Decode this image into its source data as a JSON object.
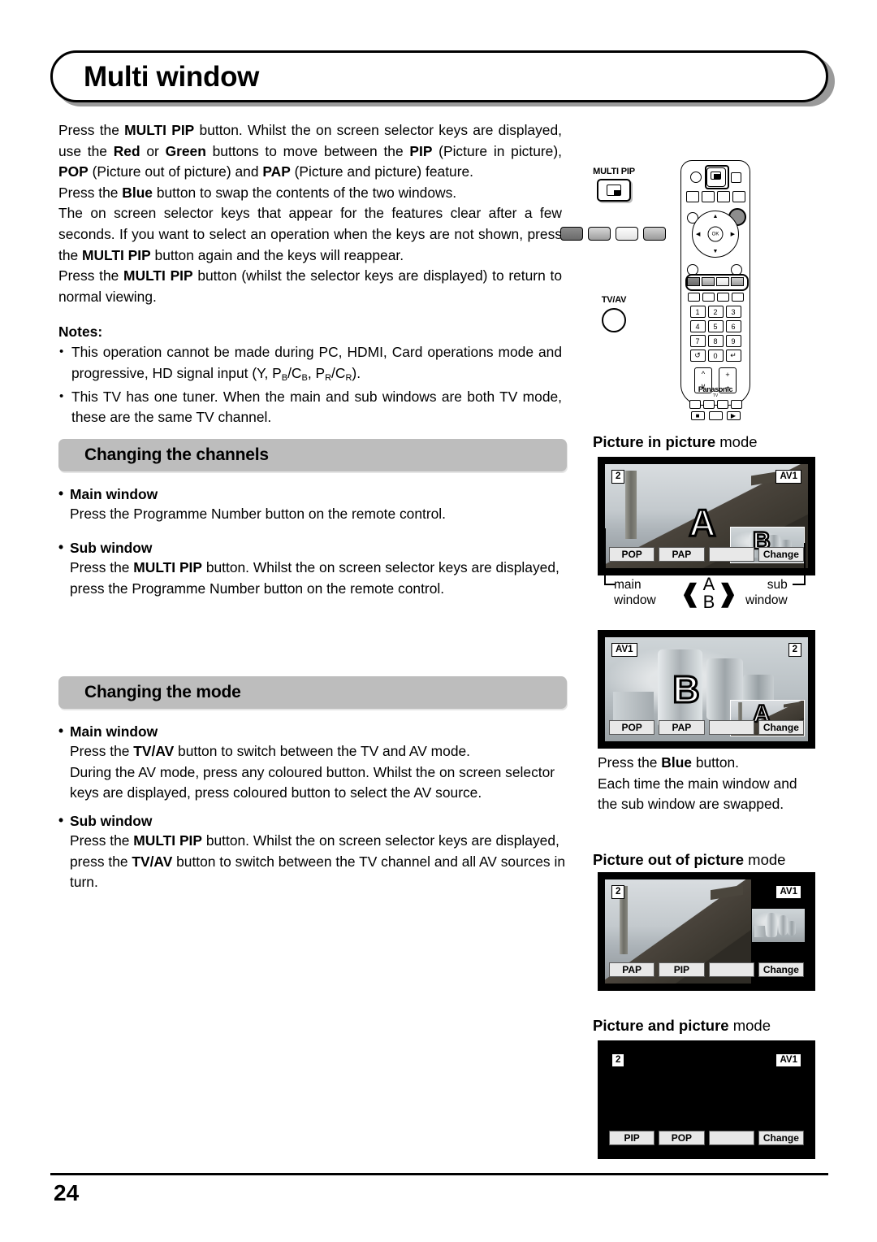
{
  "page": {
    "title": "Multi window",
    "number": "24"
  },
  "intro": {
    "para1_parts": [
      {
        "t": "Press the ",
        "b": false
      },
      {
        "t": "MULTI PIP",
        "b": true
      },
      {
        "t": " button. Whilst the on screen selector keys are displayed, use the ",
        "b": false
      },
      {
        "t": "Red",
        "b": true
      },
      {
        "t": " or ",
        "b": false
      },
      {
        "t": "Green",
        "b": true
      },
      {
        "t": " buttons to move between the ",
        "b": false
      },
      {
        "t": "PIP",
        "b": true
      },
      {
        "t": " (Picture in picture), ",
        "b": false
      },
      {
        "t": "POP",
        "b": true
      },
      {
        "t": " (Picture out of picture) and ",
        "b": false
      },
      {
        "t": "PAP",
        "b": true
      },
      {
        "t": " (Picture and picture) feature.",
        "b": false
      }
    ],
    "para2_parts": [
      {
        "t": "Press the ",
        "b": false
      },
      {
        "t": "Blue",
        "b": true
      },
      {
        "t": " button to swap the contents of the two windows.",
        "b": false
      }
    ],
    "para3_parts": [
      {
        "t": "The on screen selector keys that appear for the features clear after a few seconds. If you want to select an operation when the keys are not shown, press the ",
        "b": false
      },
      {
        "t": "MULTI PIP",
        "b": true
      },
      {
        "t": " button again and the keys will reappear.",
        "b": false
      }
    ],
    "para4_parts": [
      {
        "t": "Press the ",
        "b": false
      },
      {
        "t": "MULTI PIP",
        "b": true
      },
      {
        "t": " button (whilst the selector keys are displayed) to return to normal viewing.",
        "b": false
      }
    ]
  },
  "notes": {
    "heading": "Notes:",
    "items": [
      "This operation cannot be made during PC, HDMI, Card operations mode and progressive, HD signal input (Y, PB/CB, PR/CR).",
      "This TV has one tuner. When the main and sub windows are both TV mode, these are the same TV channel."
    ],
    "item1_pre": "This operation cannot be made during PC, HDMI, Card operations mode and progressive, HD signal input (Y, P",
    "item1_sub1": "B",
    "item1_mid1": "/C",
    "item1_sub2": "B",
    "item1_mid2": ", P",
    "item1_sub3": "R",
    "item1_mid3": "/C",
    "item1_sub4": "R",
    "item1_post": ")."
  },
  "remote": {
    "multipip_label": "MULTI PIP",
    "tvav_label": "TV/AV",
    "brand": "Panasonic",
    "brand_sub": "TV",
    "numbers": [
      "1",
      "2",
      "3",
      "4",
      "5",
      "6",
      "7",
      "8",
      "9",
      "0"
    ]
  },
  "sections": [
    {
      "title": "Changing the channels",
      "blocks": [
        {
          "head": "Main window",
          "body_parts": [
            {
              "t": "Press the Programme Number button on the remote control.",
              "b": false
            }
          ]
        },
        {
          "head": "Sub window",
          "body_parts": [
            {
              "t": "Press the ",
              "b": false
            },
            {
              "t": "MULTI PIP",
              "b": true
            },
            {
              "t": " button. Whilst the on screen selector keys are displayed, press the Programme Number button on the remote control.",
              "b": false
            }
          ]
        }
      ]
    },
    {
      "title": "Changing the mode",
      "blocks": [
        {
          "head": "Main window",
          "body_parts": [
            {
              "t": "Press the ",
              "b": false
            },
            {
              "t": "TV/AV",
              "b": true
            },
            {
              "t": " button to switch between the TV and AV mode.\nDuring the AV mode, press any coloured button. Whilst the on screen selector keys are displayed, press coloured button to select the AV source.",
              "b": false
            }
          ]
        },
        {
          "head": "Sub window",
          "body_parts": [
            {
              "t": "Press the ",
              "b": false
            },
            {
              "t": "MULTI PIP",
              "b": true
            },
            {
              "t": " button. Whilst the on screen selector keys are displayed, press the ",
              "b": false
            },
            {
              "t": "TV/AV",
              "b": true
            },
            {
              "t": " button to switch between the TV channel and all AV sources in turn.",
              "b": false
            }
          ]
        }
      ]
    }
  ],
  "figures": {
    "pip": {
      "heading_bold": "Picture in picture",
      "heading_light": " mode",
      "screen1": {
        "tag_left": "2",
        "tag_right": "AV1",
        "main_letter": "A",
        "sub_letter": "B",
        "selector_keys": [
          "POP",
          "PAP",
          "",
          "Change"
        ]
      },
      "screen2": {
        "tag_left": "AV1",
        "tag_right": "2",
        "main_letter": "B",
        "sub_letter": "A",
        "selector_keys": [
          "POP",
          "PAP",
          "",
          "Change"
        ]
      },
      "label_main": "main\nwindow",
      "label_main_line1": "main",
      "label_main_line2": "window",
      "label_sub_line1": "sub",
      "label_sub_line2": "window",
      "swap_top": "A",
      "swap_bottom": "B",
      "caption_parts": [
        {
          "t": "Press the ",
          "b": false
        },
        {
          "t": "Blue",
          "b": true
        },
        {
          "t": " button.\nEach time the main window and the sub window are swapped.",
          "b": false
        }
      ]
    },
    "pop": {
      "heading_bold": "Picture out of picture",
      "heading_light": " mode",
      "screen": {
        "tag_left": "2",
        "tag_right": "AV1",
        "selector_keys": [
          "PAP",
          "PIP",
          "",
          "Change"
        ]
      }
    },
    "pap": {
      "heading_bold": "Picture and picture",
      "heading_light": " mode",
      "screen": {
        "tag_left": "2",
        "tag_right": "AV1",
        "selector_keys": [
          "PIP",
          "POP",
          "",
          "Change"
        ]
      }
    }
  }
}
